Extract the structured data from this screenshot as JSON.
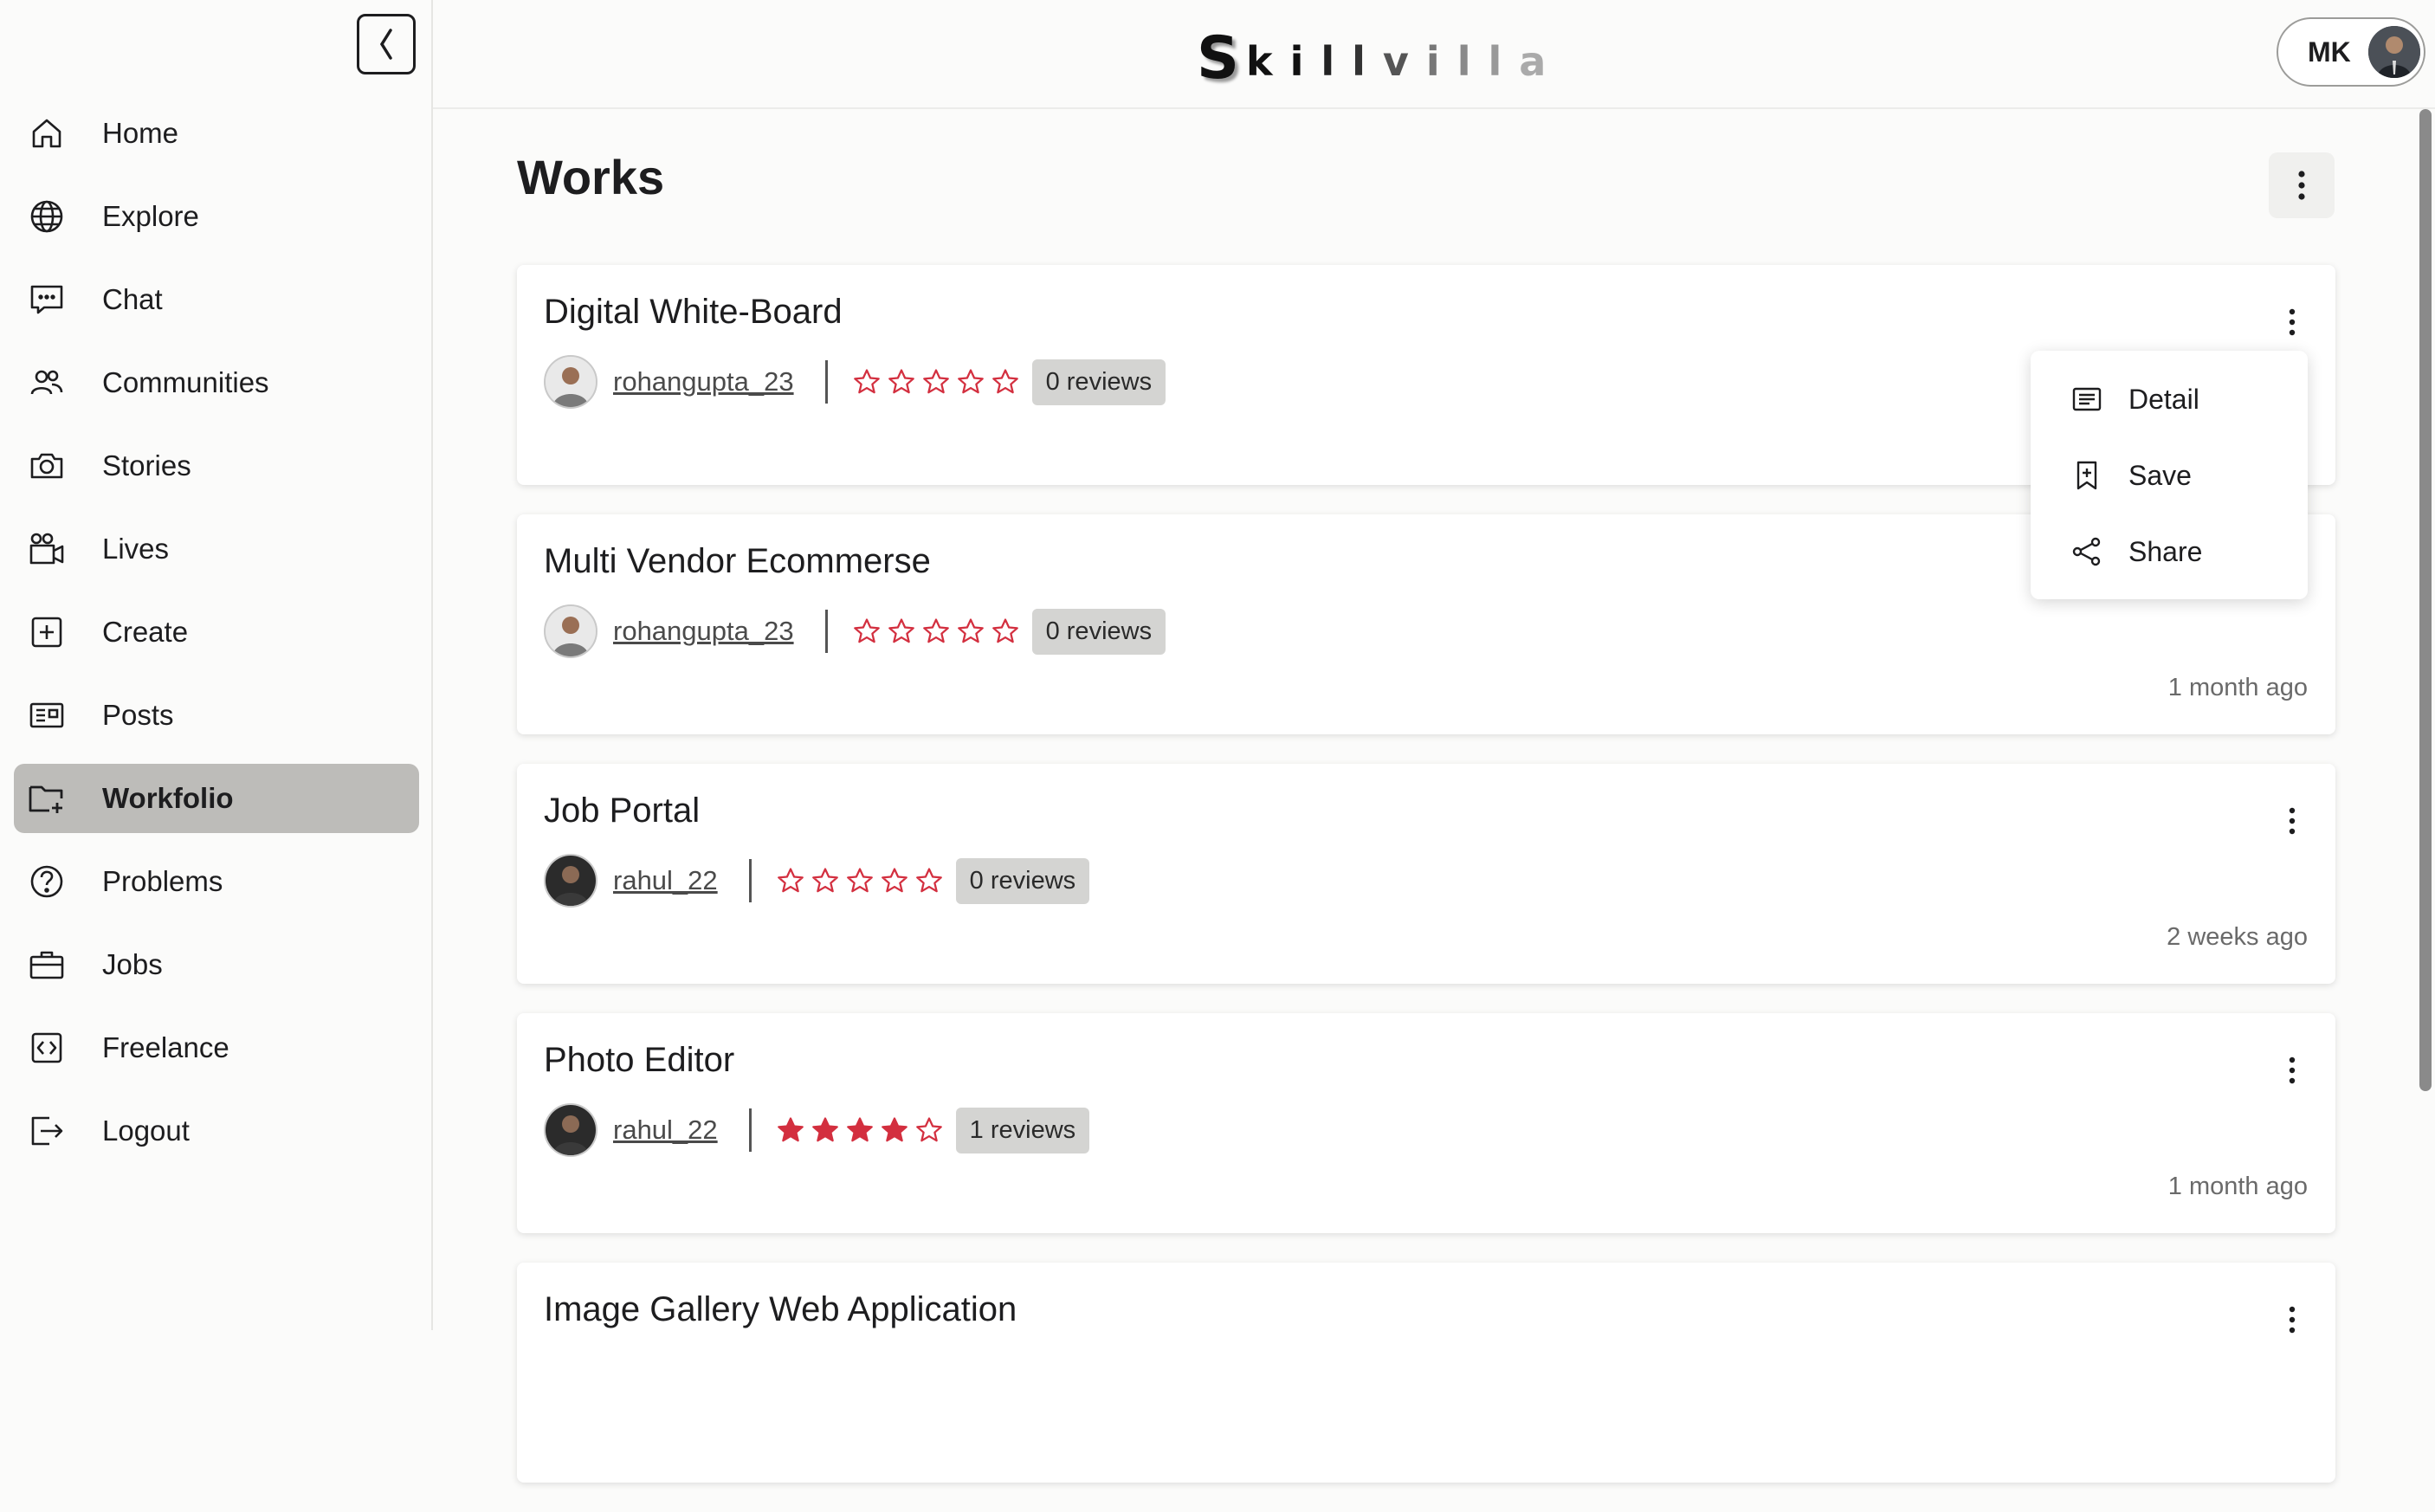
{
  "sidebar": {
    "items": [
      {
        "label": "Home",
        "icon": "home-icon"
      },
      {
        "label": "Explore",
        "icon": "globe-icon"
      },
      {
        "label": "Chat",
        "icon": "chat-icon"
      },
      {
        "label": "Communities",
        "icon": "users-icon"
      },
      {
        "label": "Stories",
        "icon": "camera-icon"
      },
      {
        "label": "Lives",
        "icon": "video-icon"
      },
      {
        "label": "Create",
        "icon": "plus-square-icon"
      },
      {
        "label": "Posts",
        "icon": "newspaper-icon"
      },
      {
        "label": "Workfolio",
        "icon": "folder-plus-icon",
        "active": true
      },
      {
        "label": "Problems",
        "icon": "question-circle-icon"
      },
      {
        "label": "Jobs",
        "icon": "briefcase-icon"
      },
      {
        "label": "Freelance",
        "icon": "code-icon"
      },
      {
        "label": "Logout",
        "icon": "logout-icon"
      }
    ]
  },
  "header": {
    "logo": {
      "first": "S",
      "rest": "killvilla"
    },
    "user_initials": "MK"
  },
  "main": {
    "title": "Works",
    "cards": [
      {
        "title": "Digital White-Board",
        "user": "rohangupta_23",
        "rating": 0,
        "reviews": "0 reviews",
        "time": ""
      },
      {
        "title": "Multi Vendor Ecommerse",
        "user": "rohangupta_23",
        "rating": 0,
        "reviews": "0 reviews",
        "time": "1 month ago"
      },
      {
        "title": "Job Portal",
        "user": "rahul_22",
        "rating": 0,
        "reviews": "0 reviews",
        "time": "2 weeks ago"
      },
      {
        "title": "Photo Editor",
        "user": "rahul_22",
        "rating": 4,
        "reviews": "1 reviews",
        "time": "1 month ago"
      },
      {
        "title": "Image Gallery Web Application",
        "user": "",
        "rating": 0,
        "reviews": "",
        "time": ""
      }
    ],
    "dropdown": [
      {
        "label": "Detail",
        "icon": "detail-icon"
      },
      {
        "label": "Save",
        "icon": "bookmark-icon"
      },
      {
        "label": "Share",
        "icon": "share-icon"
      }
    ]
  },
  "colors": {
    "star": "#d32f3f",
    "active_bg": "#bdbcb9"
  }
}
